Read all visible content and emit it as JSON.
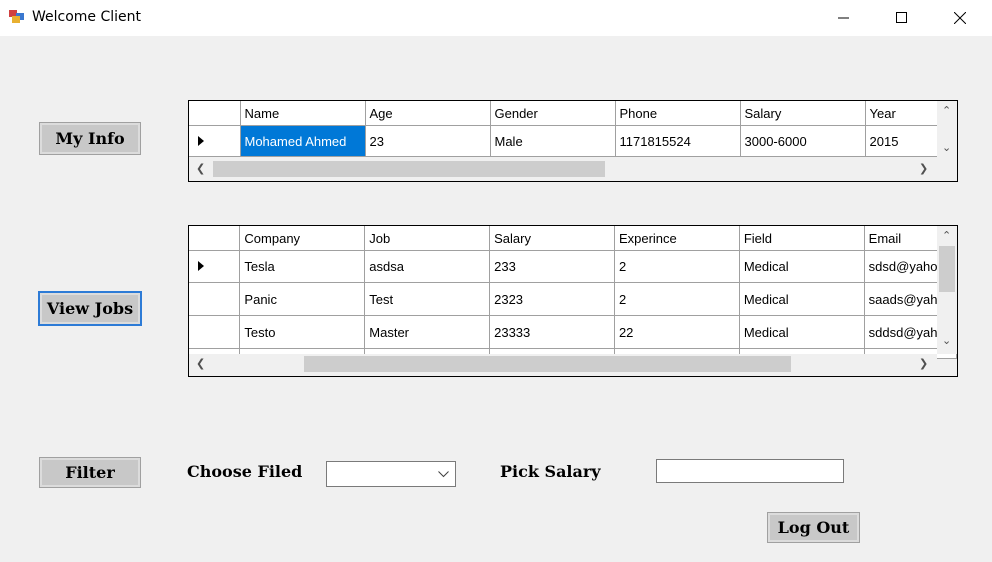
{
  "window": {
    "title": "Welcome Client"
  },
  "buttons": {
    "my_info": "My Info",
    "view_jobs": "View Jobs",
    "filter": "Filter",
    "log_out": "Log Out"
  },
  "info_grid": {
    "columns": [
      "Name",
      "Age",
      "Gender",
      "Phone",
      "Salary",
      "Year"
    ],
    "rows": [
      [
        "Mohamed Ahmed",
        "23",
        "Male",
        "1171815524",
        "3000-6000",
        "2015"
      ]
    ]
  },
  "jobs_grid": {
    "columns": [
      "Company",
      "Job",
      "Salary",
      "Experince",
      "Field",
      "Email"
    ],
    "rows": [
      [
        "Tesla",
        "asdsa",
        "233",
        "2",
        "Medical",
        "sdsd@yahoo"
      ],
      [
        "Panic",
        "Test",
        "2323",
        "2",
        "Medical",
        "saads@yahoo"
      ],
      [
        "Testo",
        "Master",
        "23333",
        "22",
        "Medical",
        "sddsd@yahoo"
      ]
    ]
  },
  "filter": {
    "choose_field_label": "Choose Filed",
    "choose_field_value": "",
    "pick_salary_label": "Pick Salary",
    "pick_salary_value": ""
  }
}
